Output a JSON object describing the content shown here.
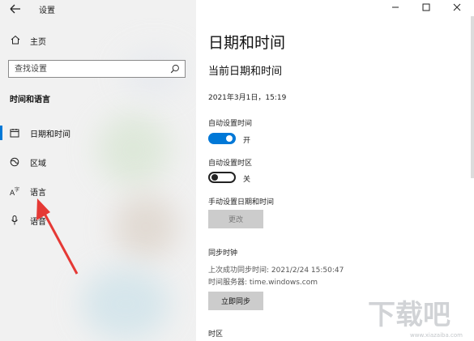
{
  "app": {
    "title": "设置",
    "window_controls": [
      "minimize-icon",
      "maximize-icon",
      "close-icon"
    ]
  },
  "sidebar": {
    "home_label": "主页",
    "search_placeholder": "查找设置",
    "section_heading": "时间和语言",
    "items": [
      {
        "label": "日期和时间",
        "icon": "clock-calendar-icon",
        "selected": true
      },
      {
        "label": "区域",
        "icon": "globe-region-icon",
        "selected": false
      },
      {
        "label": "语言",
        "icon": "language-icon",
        "selected": false
      },
      {
        "label": "语音",
        "icon": "microphone-icon",
        "selected": false
      }
    ]
  },
  "main": {
    "page_title": "日期和时间",
    "current_heading": "当前日期和时间",
    "current_datetime": "2021年3月1日，15:19",
    "auto_time": {
      "label": "自动设置时间",
      "state_text": "开",
      "on": true
    },
    "auto_timezone": {
      "label": "自动设置时区",
      "state_text": "关",
      "on": false
    },
    "manual": {
      "label": "手动设置日期和时间",
      "button": "更改"
    },
    "sync": {
      "heading": "同步时钟",
      "last_sync": "上次成功同步时间: 2021/2/24 15:50:47",
      "server": "时间服务器: time.windows.com",
      "button": "立即同步"
    },
    "timezone_heading": "时区"
  },
  "colors": {
    "accent": "#0078d7",
    "arrow": "#e53935",
    "sidebar_bg": "#f1f1f1"
  },
  "watermark": {
    "text": "下载吧",
    "url": "www.xiazaiba.com"
  }
}
